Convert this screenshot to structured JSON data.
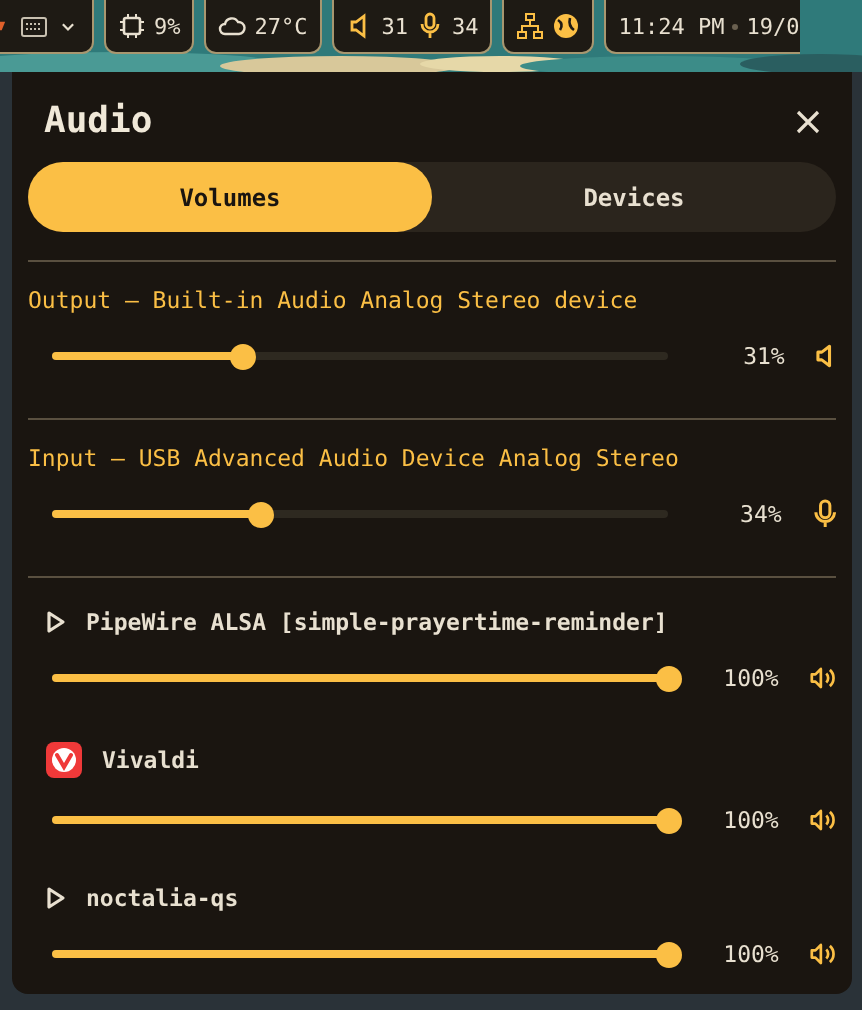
{
  "top_bar": {
    "cpu": "9%",
    "weather": "27°C",
    "volume": "31",
    "mic": "34",
    "time": "11:24 PM",
    "date": "19/0"
  },
  "panel": {
    "title": "Audio",
    "tabs": [
      {
        "label": "Volumes",
        "selected": true
      },
      {
        "label": "Devices",
        "selected": false
      }
    ],
    "sections": [
      {
        "kind": "output",
        "name": "Output — Built-in Audio Analog Stereo device",
        "level": 0.31,
        "reading": "31%"
      },
      {
        "kind": "input",
        "name": "Input — USB Advanced Audio Device Analog Stereo",
        "level": 0.34,
        "reading": "34%"
      },
      {
        "kind": "stream",
        "name": "PipeWire ALSA [simple-prayertime-reminder]",
        "level": 1,
        "reading": "100%"
      },
      {
        "kind": "app",
        "name": "Vivaldi",
        "level": 1,
        "reading": "100%"
      },
      {
        "kind": "stream",
        "name": "noctalia-qs",
        "level": 1,
        "reading": "100%"
      }
    ]
  }
}
